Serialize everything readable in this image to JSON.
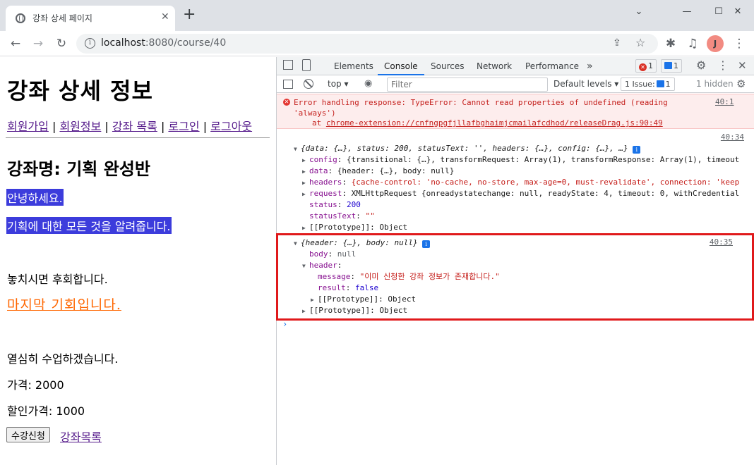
{
  "browser": {
    "tab_title": "강좌 상세 페이지",
    "url_host": "localhost",
    "url_path": ":8080/course/40",
    "avatar_letter": "J"
  },
  "page": {
    "title": "강좌 상세 정보",
    "nav": [
      "회원가입",
      "회원정보",
      "강좌 목록",
      "로그인",
      "로그아웃"
    ],
    "nav_separator": " | ",
    "course_name": "강좌명: 기획 완성반",
    "intro1": "안녕하세요.",
    "intro2": "기획에 대한 모든 것을 알려줍니다.",
    "body3": "놓치시면 후회합니다.",
    "body4": "마지막 기회입니다.",
    "body5": "열심히 수업하겠습니다.",
    "price": "가격: 2000",
    "discount": "할인가격: 1000",
    "enroll_button": "수강신청",
    "course_list_link": "강좌목록"
  },
  "devtools": {
    "tabs": [
      "Elements",
      "Console",
      "Sources",
      "Network",
      "Performance"
    ],
    "active_tab": "Console",
    "error_count": "1",
    "message_count": "1",
    "context": "top",
    "filter_placeholder": "Filter",
    "levels": "Default levels",
    "issues": "1 Issue:",
    "issues_count": "1",
    "hidden": "1 hidden",
    "error_line1": "Error handling response: TypeError: Cannot read properties of undefined (reading",
    "error_line2": "'always')",
    "error_at": "at",
    "error_source_url": "chrome-extension://cnfngpgfjllafbghaimjcmailafcdhod/releaseDrag.js:90:49",
    "error_src": "40:1",
    "log1_src": "40:34",
    "log1_summary": "{data: {…}, status: 200, statusText: '', headers: {…}, config: {…}, …}",
    "log1_config": "{transitional: {…}, transformRequest: Array(1), transformResponse: Array(1), timeout",
    "log1_data": "{header: {…}, body: null}",
    "log1_headers": "{cache-control: 'no-cache, no-store, max-age=0, must-revalidate', connection: 'keep",
    "log1_request": "XMLHttpRequest {onreadystatechange: null, readyState: 4, timeout: 0, withCredential",
    "log1_status": "200",
    "log1_statusText": "\"\"",
    "prototype": "[[Prototype]]: Object",
    "log2_src": "40:35",
    "log2_summary": "{header: {…}, body: null}",
    "log2_body": "null",
    "log2_message": "\"이미 신청한 강좌 정보가 존재합니다.\"",
    "log2_result": "false",
    "prompt": "›"
  },
  "colors": {
    "selection": "#3c3cdc",
    "orange_link": "#ff6600",
    "error_bg": "#fdeded",
    "highlight": "#e0191b"
  }
}
